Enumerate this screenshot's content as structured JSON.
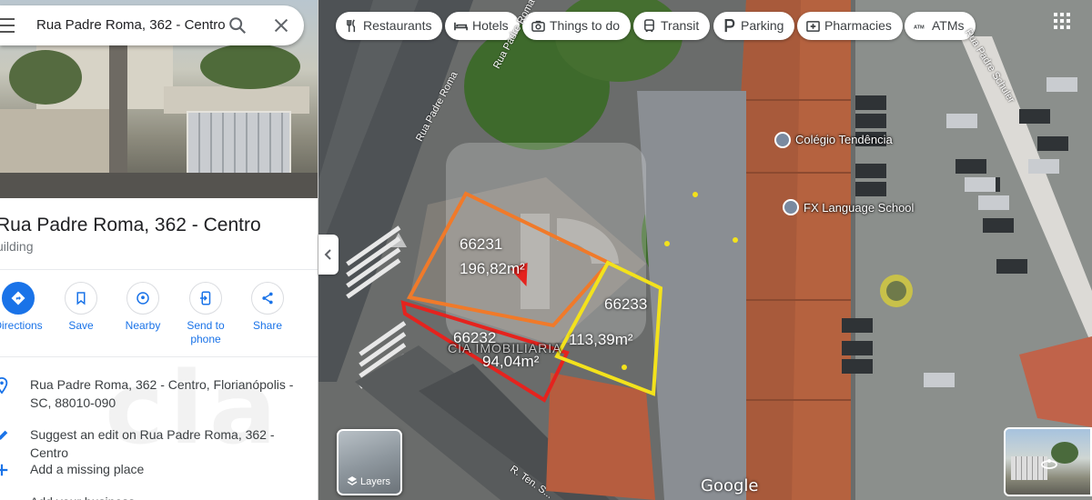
{
  "search": {
    "query": "Rua Padre Roma, 362 - Centro"
  },
  "place": {
    "title": "Rua Padre Roma, 362 - Centro",
    "category": "uilding"
  },
  "actions": [
    {
      "label": "Directions",
      "icon": "directions-icon"
    },
    {
      "label": "Save",
      "icon": "bookmark-icon"
    },
    {
      "label": "Nearby",
      "icon": "nearby-icon"
    },
    {
      "label": "Send to phone",
      "icon": "send-to-phone-icon"
    },
    {
      "label": "Share",
      "icon": "share-icon"
    }
  ],
  "info": {
    "address": "Rua Padre Roma, 362 - Centro, Florianópolis - SC, 88010-090",
    "suggest_prefix": "Suggest an edit on ",
    "suggest_place": "Rua Padre Roma, 362 - Centro",
    "missing_place": "Add a missing place",
    "add_business": "Add your business"
  },
  "watermark": "cia",
  "map": {
    "chips": [
      "Restaurants",
      "Hotels",
      "Things to do",
      "Transit",
      "Parking",
      "Pharmacies",
      "ATMs"
    ],
    "pois": [
      "Colégio Tendência",
      "FX Language School"
    ],
    "streets": [
      "Rua Padre Roma",
      "Rua Padre Roma",
      "R. Ten. S...",
      "Rua Padre Schuler"
    ],
    "lots": [
      {
        "id": "66231",
        "area": "196,82m²",
        "color": "#f07a2a"
      },
      {
        "id": "66232",
        "area": "94,04m²",
        "color": "#e5231e"
      },
      {
        "id": "66233",
        "area": "113,39m²",
        "color": "#f3e21c"
      }
    ],
    "overlay_brand": "CIA IMOBILIARIA",
    "layers_label": "Layers",
    "attribution": "Google"
  },
  "colors": {
    "accent": "#1a73e8"
  }
}
